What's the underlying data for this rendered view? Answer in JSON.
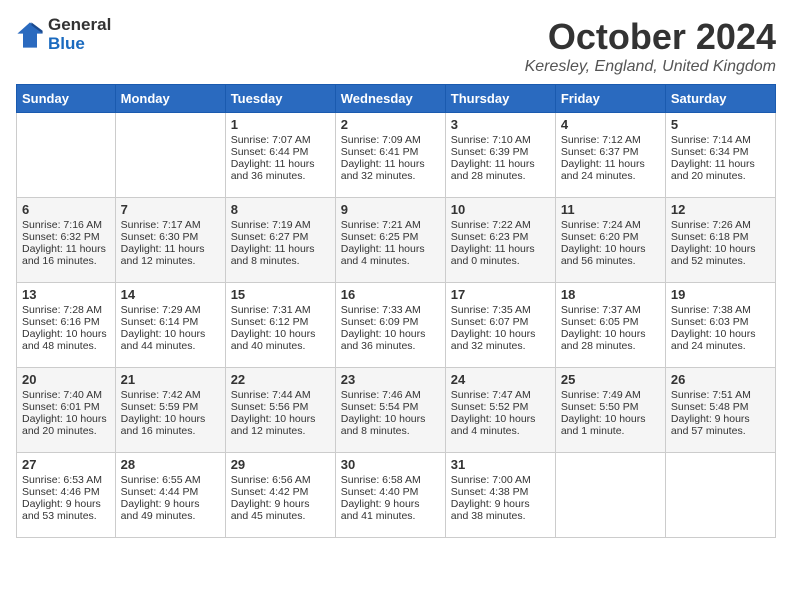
{
  "header": {
    "logo_general": "General",
    "logo_blue": "Blue",
    "month": "October 2024",
    "location": "Keresley, England, United Kingdom"
  },
  "days_of_week": [
    "Sunday",
    "Monday",
    "Tuesday",
    "Wednesday",
    "Thursday",
    "Friday",
    "Saturday"
  ],
  "weeks": [
    [
      {
        "day": "",
        "text": ""
      },
      {
        "day": "",
        "text": ""
      },
      {
        "day": "1",
        "text": "Sunrise: 7:07 AM\nSunset: 6:44 PM\nDaylight: 11 hours and 36 minutes."
      },
      {
        "day": "2",
        "text": "Sunrise: 7:09 AM\nSunset: 6:41 PM\nDaylight: 11 hours and 32 minutes."
      },
      {
        "day": "3",
        "text": "Sunrise: 7:10 AM\nSunset: 6:39 PM\nDaylight: 11 hours and 28 minutes."
      },
      {
        "day": "4",
        "text": "Sunrise: 7:12 AM\nSunset: 6:37 PM\nDaylight: 11 hours and 24 minutes."
      },
      {
        "day": "5",
        "text": "Sunrise: 7:14 AM\nSunset: 6:34 PM\nDaylight: 11 hours and 20 minutes."
      }
    ],
    [
      {
        "day": "6",
        "text": "Sunrise: 7:16 AM\nSunset: 6:32 PM\nDaylight: 11 hours and 16 minutes."
      },
      {
        "day": "7",
        "text": "Sunrise: 7:17 AM\nSunset: 6:30 PM\nDaylight: 11 hours and 12 minutes."
      },
      {
        "day": "8",
        "text": "Sunrise: 7:19 AM\nSunset: 6:27 PM\nDaylight: 11 hours and 8 minutes."
      },
      {
        "day": "9",
        "text": "Sunrise: 7:21 AM\nSunset: 6:25 PM\nDaylight: 11 hours and 4 minutes."
      },
      {
        "day": "10",
        "text": "Sunrise: 7:22 AM\nSunset: 6:23 PM\nDaylight: 11 hours and 0 minutes."
      },
      {
        "day": "11",
        "text": "Sunrise: 7:24 AM\nSunset: 6:20 PM\nDaylight: 10 hours and 56 minutes."
      },
      {
        "day": "12",
        "text": "Sunrise: 7:26 AM\nSunset: 6:18 PM\nDaylight: 10 hours and 52 minutes."
      }
    ],
    [
      {
        "day": "13",
        "text": "Sunrise: 7:28 AM\nSunset: 6:16 PM\nDaylight: 10 hours and 48 minutes."
      },
      {
        "day": "14",
        "text": "Sunrise: 7:29 AM\nSunset: 6:14 PM\nDaylight: 10 hours and 44 minutes."
      },
      {
        "day": "15",
        "text": "Sunrise: 7:31 AM\nSunset: 6:12 PM\nDaylight: 10 hours and 40 minutes."
      },
      {
        "day": "16",
        "text": "Sunrise: 7:33 AM\nSunset: 6:09 PM\nDaylight: 10 hours and 36 minutes."
      },
      {
        "day": "17",
        "text": "Sunrise: 7:35 AM\nSunset: 6:07 PM\nDaylight: 10 hours and 32 minutes."
      },
      {
        "day": "18",
        "text": "Sunrise: 7:37 AM\nSunset: 6:05 PM\nDaylight: 10 hours and 28 minutes."
      },
      {
        "day": "19",
        "text": "Sunrise: 7:38 AM\nSunset: 6:03 PM\nDaylight: 10 hours and 24 minutes."
      }
    ],
    [
      {
        "day": "20",
        "text": "Sunrise: 7:40 AM\nSunset: 6:01 PM\nDaylight: 10 hours and 20 minutes."
      },
      {
        "day": "21",
        "text": "Sunrise: 7:42 AM\nSunset: 5:59 PM\nDaylight: 10 hours and 16 minutes."
      },
      {
        "day": "22",
        "text": "Sunrise: 7:44 AM\nSunset: 5:56 PM\nDaylight: 10 hours and 12 minutes."
      },
      {
        "day": "23",
        "text": "Sunrise: 7:46 AM\nSunset: 5:54 PM\nDaylight: 10 hours and 8 minutes."
      },
      {
        "day": "24",
        "text": "Sunrise: 7:47 AM\nSunset: 5:52 PM\nDaylight: 10 hours and 4 minutes."
      },
      {
        "day": "25",
        "text": "Sunrise: 7:49 AM\nSunset: 5:50 PM\nDaylight: 10 hours and 1 minute."
      },
      {
        "day": "26",
        "text": "Sunrise: 7:51 AM\nSunset: 5:48 PM\nDaylight: 9 hours and 57 minutes."
      }
    ],
    [
      {
        "day": "27",
        "text": "Sunrise: 6:53 AM\nSunset: 4:46 PM\nDaylight: 9 hours and 53 minutes."
      },
      {
        "day": "28",
        "text": "Sunrise: 6:55 AM\nSunset: 4:44 PM\nDaylight: 9 hours and 49 minutes."
      },
      {
        "day": "29",
        "text": "Sunrise: 6:56 AM\nSunset: 4:42 PM\nDaylight: 9 hours and 45 minutes."
      },
      {
        "day": "30",
        "text": "Sunrise: 6:58 AM\nSunset: 4:40 PM\nDaylight: 9 hours and 41 minutes."
      },
      {
        "day": "31",
        "text": "Sunrise: 7:00 AM\nSunset: 4:38 PM\nDaylight: 9 hours and 38 minutes."
      },
      {
        "day": "",
        "text": ""
      },
      {
        "day": "",
        "text": ""
      }
    ]
  ]
}
